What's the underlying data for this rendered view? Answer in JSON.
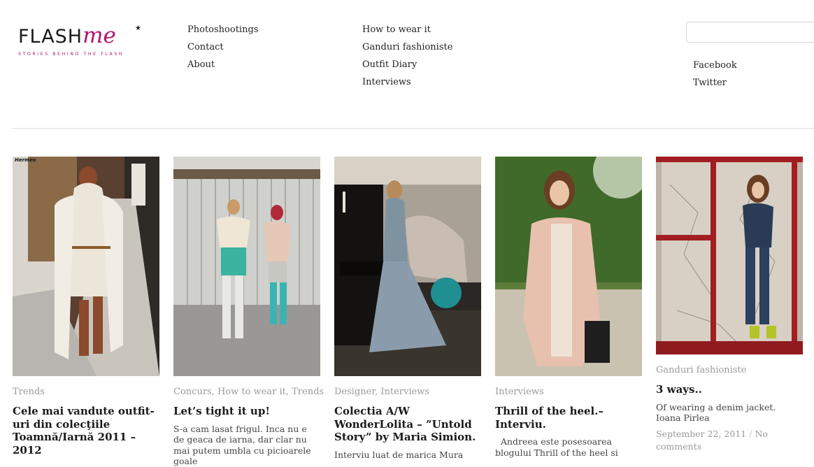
{
  "logo": {
    "main": "FLASH",
    "accent": "me",
    "tagline": "STORIES BEHIND THE FLASH"
  },
  "nav": {
    "col1": [
      "Photoshootings",
      "Contact",
      "About"
    ],
    "col2": [
      "How to wear it",
      "Ganduri fashioniste",
      "Outfit Diary",
      "Interviews"
    ],
    "social": [
      "Facebook",
      "Twitter"
    ]
  },
  "search": {
    "value": "",
    "placeholder": ""
  },
  "posts": [
    {
      "categories": "Trends",
      "title": "Cele mai vandute outfit-uri din colecţiile Toamnă/Iarnă 2011 – 2012",
      "excerpt": "",
      "watermark": "Hermes"
    },
    {
      "categories": "Concurs, How to wear it, Trends",
      "title": "Let’s tight it up!",
      "excerpt": "S-a cam lasat frigul. Inca nu e de geaca de iarna, dar clar nu mai putem umbla cu picioarele goale"
    },
    {
      "categories": "Designer, Interviews",
      "title": "Colectia A/W WonderLolita – ”Untold Story” by Maria Simion.",
      "excerpt": "Interviu luat de marica Mura"
    },
    {
      "categories": "Interviews",
      "title": "Thrill of the heel.– Interviu.",
      "excerpt": "  Andreea este posesoarea blogului Thrill of the heel si"
    },
    {
      "categories": "Ganduri fashioniste",
      "title": "3 ways..",
      "excerpt": "Of wearing a denim jacket. Ioana Pirlea",
      "date": "September 22, 2011",
      "separator": "/",
      "comments": "No comments"
    }
  ],
  "colors": {
    "accent": "#b0156a",
    "category": "#9a9a9a",
    "divider": "#dedede"
  }
}
